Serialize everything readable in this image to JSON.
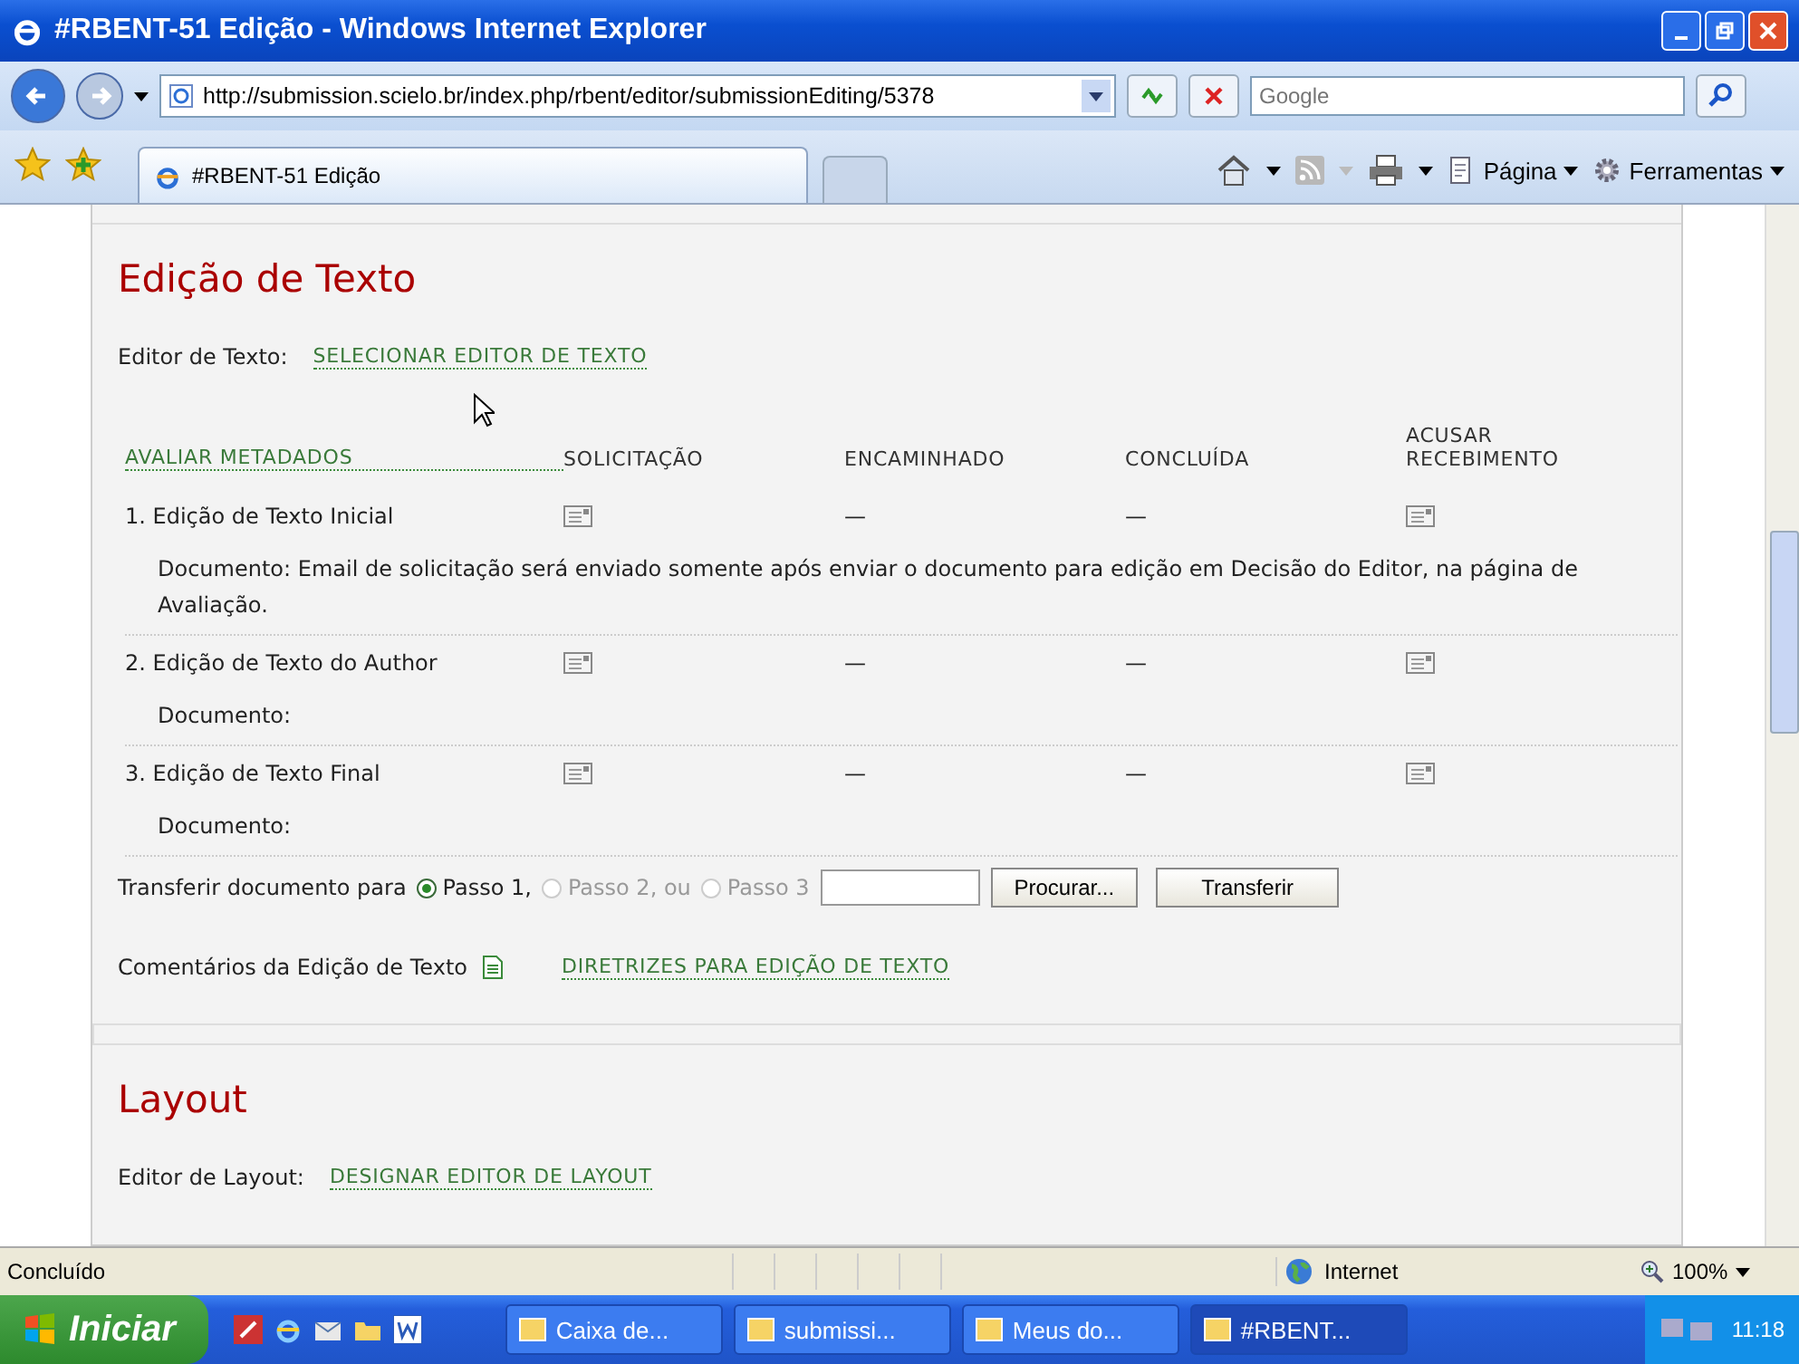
{
  "window": {
    "title": "#RBENT-51 Edição - Windows Internet Explorer"
  },
  "toolbar": {
    "address": "http://submission.scielo.br/index.php/rbent/editor/submissionEditing/5378",
    "search_placeholder": "Google",
    "tab": "#RBENT-51 Edição",
    "commands": [
      "Página",
      "Ferramentas"
    ]
  },
  "copyedit": {
    "heading": "Edição de Texto",
    "editor_label": "Editor de Texto:",
    "editor_link": "SELECIONAR EDITOR DE TEXTO",
    "columns": [
      "AVALIAR METADADOS",
      "SOLICITAÇÃO",
      "ENCAMINHADO",
      "CONCLUÍDA",
      "ACUSAR RECEBIMENTO"
    ],
    "rows": [
      {
        "document": "Documento: Email de solicitação será enviado somente após enviar o documento para edição em Decisão do Editor, na página de Avaliação.",
        "cells": [
          {
            "kind": "step",
            "text": "1. Edição de Texto Inicial"
          },
          {
            "kind": "email"
          },
          {
            "kind": "text",
            "text": "—"
          },
          {
            "kind": "text",
            "text": "—"
          },
          {
            "kind": "email"
          }
        ]
      },
      {
        "document": "Documento:",
        "cells": [
          {
            "kind": "step",
            "text": "2. Edição de Texto do Author"
          },
          {
            "kind": "email"
          },
          {
            "kind": "text",
            "text": "—"
          },
          {
            "kind": "text",
            "text": "—"
          },
          {
            "kind": "email"
          }
        ]
      },
      {
        "document": "Documento:",
        "cells": [
          {
            "kind": "step",
            "text": "3. Edição de Texto Final"
          },
          {
            "kind": "email"
          },
          {
            "kind": "text",
            "text": "—"
          },
          {
            "kind": "text",
            "text": "—"
          },
          {
            "kind": "email"
          }
        ]
      }
    ],
    "transfer_label": "Transferir documento para",
    "steps": [
      {
        "label": "Passo 1,",
        "selected": true,
        "disabled": false
      },
      {
        "label": "Passo 2, ou",
        "selected": false,
        "disabled": true
      },
      {
        "label": "Passo 3",
        "selected": false,
        "disabled": true
      }
    ],
    "browse_button": "Procurar...",
    "upload_button": "Transferir",
    "comments_label": "Comentários da Edição de Texto",
    "guidelines_link": "DIRETRIZES PARA EDIÇÃO DE TEXTO"
  },
  "layout": {
    "heading": "Layout",
    "editor_label": "Editor de Layout:",
    "editor_link": "DESIGNAR EDITOR DE LAYOUT"
  },
  "status_bar": {
    "text": "Concluído",
    "zone": "Internet",
    "zoom": "100%"
  },
  "taskbar": {
    "start": "Iniciar",
    "tasks": [
      {
        "label": "Caixa de...",
        "selected": false
      },
      {
        "label": "submissi...",
        "selected": false
      },
      {
        "label": "Meus do...",
        "selected": false
      },
      {
        "label": "#RBENT...",
        "selected": true
      }
    ],
    "clock": "11:18"
  }
}
